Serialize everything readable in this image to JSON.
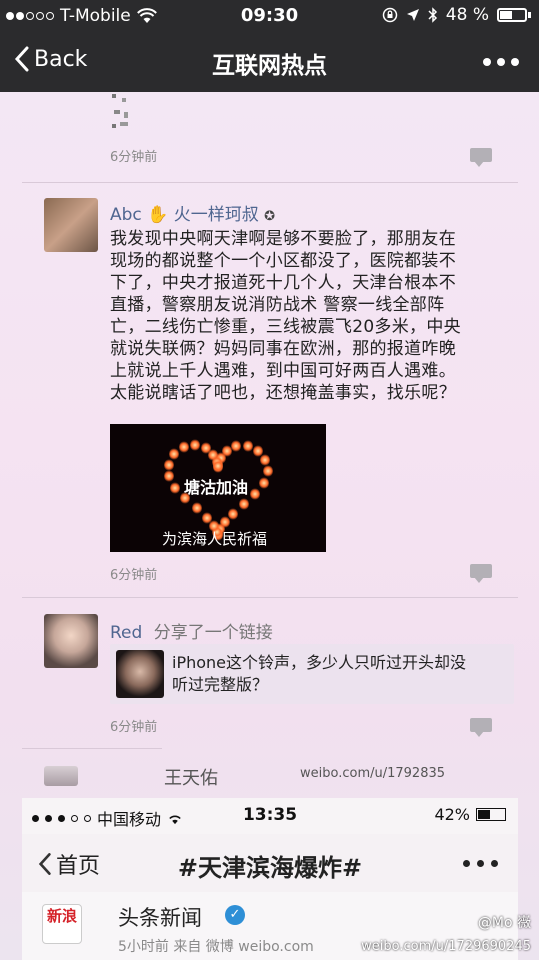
{
  "status_bar": {
    "carrier": "T-Mobile",
    "time": "09:30",
    "battery": "48 %",
    "battery_level": 0.48
  },
  "nav": {
    "back_label": "Back",
    "title": "互联网热点"
  },
  "screenshot": {
    "post0": {
      "time": "6分钟前"
    },
    "post1": {
      "name": "Abc",
      "name_suffix": "火一样珂叔",
      "lines": [
        "我发现中央啊天津啊是够不要脸了，那朋友在",
        "现场的都说整个一个小区都没了，医院都装不",
        "下了，中央才报道死十几个人，天津台根本不",
        "直播，警察朋友说消防战术 警察一线全部阵",
        "亡，二线伤亡惨重，三线被震飞20多米，中央",
        "就说失联俩？妈妈同事在欧洲，那的报道咋晚",
        "上就说上千人遇难，到中国可好两百人遇难。",
        "太能说瞎话了吧也，还想掩盖事实，找乐呢？"
      ],
      "image_center_text": "塘沽加油",
      "image_caption": "为滨海人民祈福",
      "time": "6分钟前"
    },
    "post2": {
      "name": "Red",
      "action": "分享了一个链接",
      "link_line1": "iPhone这个铃声，多少人只听过开头却没",
      "link_line2": "听过完整版？",
      "time": "6分钟前"
    },
    "post3": {
      "name": "王天佑"
    },
    "watermark": "weibo.com/u/1792835"
  },
  "inner": {
    "carrier": "中国移动",
    "time": "13:35",
    "battery": "42%",
    "battery_level": 0.42,
    "back_label": "首页",
    "title": "#天津滨海爆炸#",
    "logo_text": "新浪",
    "account_name": "头条新闻",
    "meta": "5小时前  来自 微博 weibo.com"
  },
  "bottom_watermark": {
    "user": "@Mo 嶶",
    "url": "weibo.com/u/1729690245"
  },
  "colors": {
    "nav_bg": "#2b2b2d",
    "name_blue": "#4f6690",
    "photo_bg": "#f3e7f4"
  }
}
